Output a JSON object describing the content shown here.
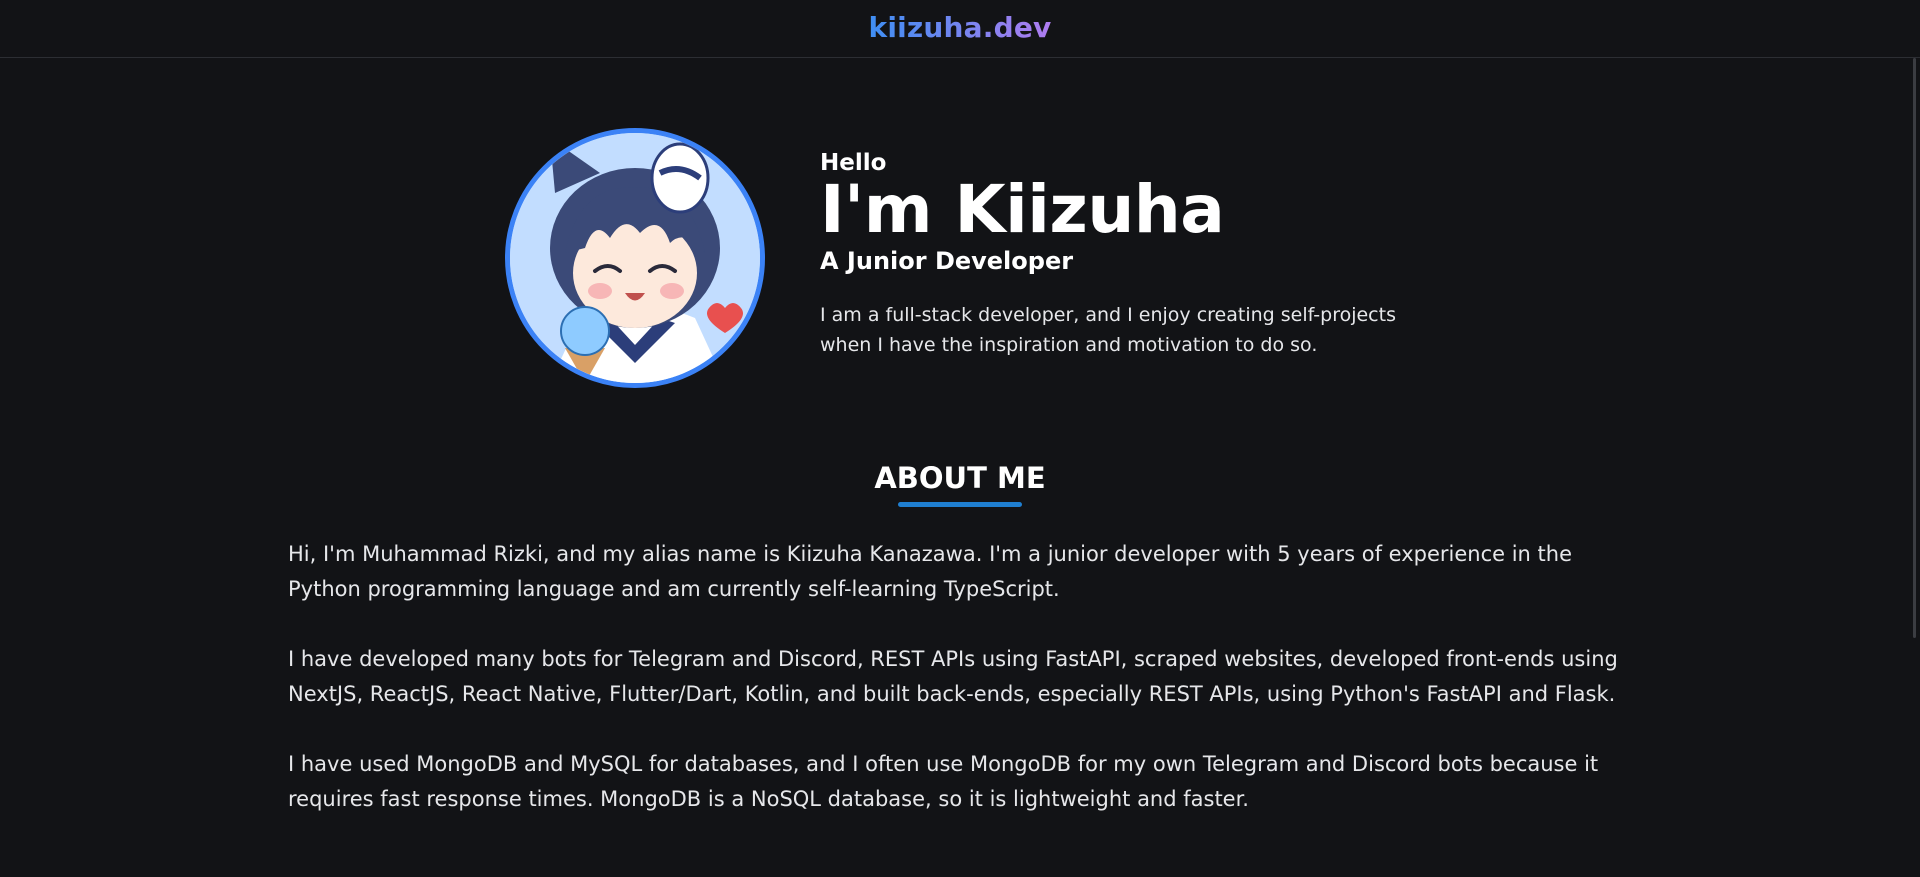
{
  "header": {
    "brand": "kiizuha.dev"
  },
  "hero": {
    "greeting": "Hello",
    "name": "I'm Kiizuha",
    "role": "A Junior Developer",
    "intro": "I am a full-stack developer, and I enjoy creating self-projects when I have the inspiration and motivation to do so.",
    "avatar_icon": "anime-avatar-icon"
  },
  "about": {
    "title": "ABOUT ME",
    "paragraphs": [
      "Hi, I'm Muhammad Rizki, and my alias name is Kiizuha Kanazawa. I'm a junior developer with 5 years of experience in the Python programming language and am currently self-learning TypeScript.",
      "I have developed many bots for Telegram and Discord, REST APIs using FastAPI, scraped websites, developed front-ends using NextJS, ReactJS, React Native, Flutter/Dart, Kotlin, and built back-ends, especially REST APIs, using Python's FastAPI and Flask.",
      "I have used MongoDB and MySQL for databases, and I often use MongoDB for my own Telegram and Discord bots because it requires fast response times. MongoDB is a NoSQL database, so it is lightweight and faster."
    ]
  },
  "colors": {
    "background": "#121316",
    "accent": "#3b82f6",
    "underline": "#1f7fd1",
    "brand_gradient_start": "#3f8ef3",
    "brand_gradient_end": "#b07cf0"
  }
}
